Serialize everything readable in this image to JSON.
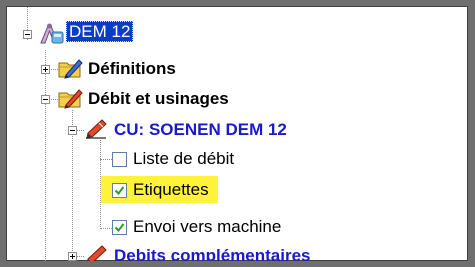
{
  "tree": {
    "root": {
      "label": "DEM 12",
      "icon": "drawing-tools-icon",
      "expanded": true
    },
    "definitions": {
      "label": "Définitions",
      "icon": "folder-pencil-icon",
      "expanded": false
    },
    "debit": {
      "label": "Débit et usinages",
      "icon": "folder-pencil-red-icon",
      "expanded": true
    },
    "cu": {
      "label": "CU: SOENEN DEM 12",
      "icon": "red-pencil-icon",
      "expanded": true
    },
    "items": [
      {
        "label": "Liste de débit",
        "checked": false,
        "highlighted": false
      },
      {
        "label": "Etiquettes",
        "checked": true,
        "highlighted": true
      },
      {
        "label": "Envoi vers machine",
        "checked": true,
        "highlighted": false
      }
    ],
    "complementaires": {
      "label": "Debits complémentaires",
      "icon": "red-pencil-icon",
      "expanded": false
    }
  },
  "colors": {
    "highlight": "#fff23a",
    "selection": "#0a3cc8",
    "node_blue": "#1a1acc"
  }
}
